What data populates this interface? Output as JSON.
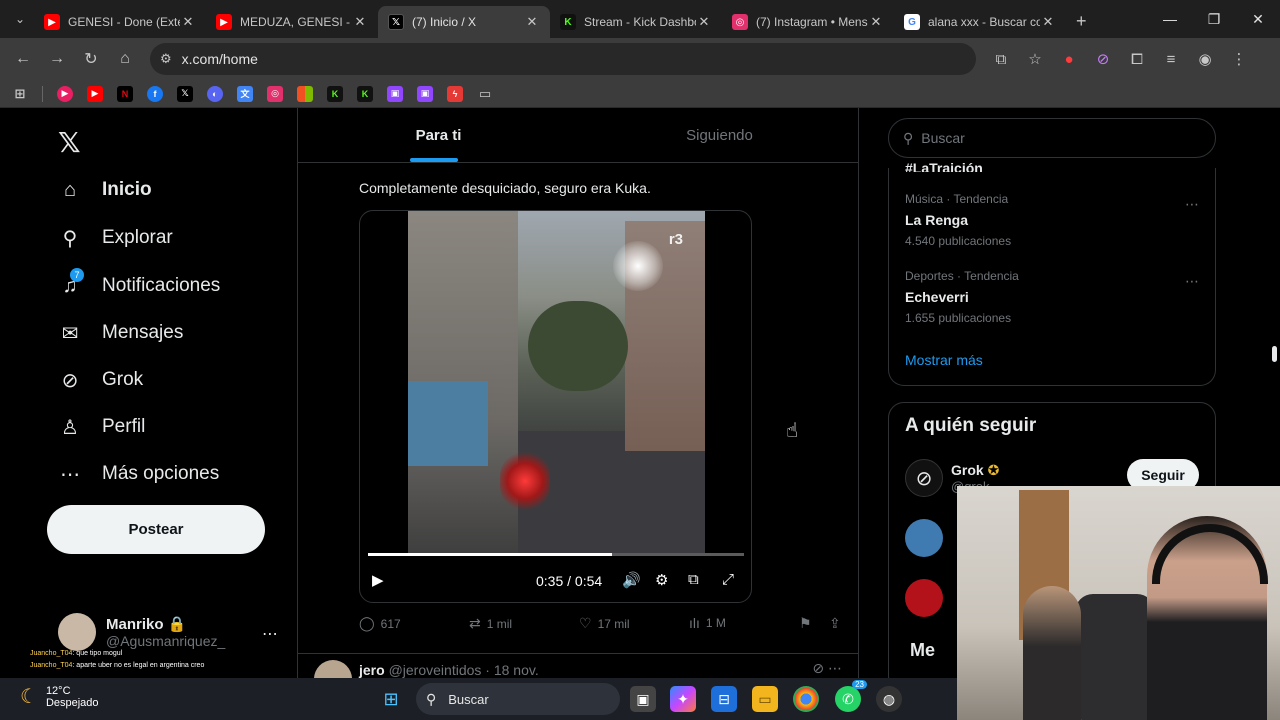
{
  "browser": {
    "tabs": [
      {
        "title": "GENESI - Done (Exter",
        "favicon_color": "#ff0000",
        "favicon": "youtube-icon"
      },
      {
        "title": "MEDUZA, GENESI - F",
        "favicon_color": "#ff0000",
        "favicon": "youtube-icon"
      },
      {
        "title": "(7) Inicio / X",
        "favicon_color": "#000000",
        "favicon": "x-logo-icon"
      },
      {
        "title": "Stream - Kick Dashbo",
        "favicon_color": "#53fc18",
        "favicon": "kick-icon"
      },
      {
        "title": "(7) Instagram • Mens",
        "favicon_color": "#e1306c",
        "favicon": "instagram-icon"
      },
      {
        "title": "alana xxx - Buscar co",
        "favicon_color": "#4285f4",
        "favicon": "google-icon"
      }
    ],
    "active_tab": 2,
    "address": "x.com/home"
  },
  "left_nav": {
    "items": [
      {
        "label": "Inicio",
        "icon": "home-icon",
        "bold": true
      },
      {
        "label": "Explorar",
        "icon": "search-icon"
      },
      {
        "label": "Notificaciones",
        "icon": "bell-icon",
        "badge": "7"
      },
      {
        "label": "Mensajes",
        "icon": "mail-icon"
      },
      {
        "label": "Grok",
        "icon": "grok-icon"
      },
      {
        "label": "Perfil",
        "icon": "person-icon"
      },
      {
        "label": "Más opciones",
        "icon": "more-circle-icon"
      }
    ],
    "post_button": "Postear",
    "account": {
      "name": "Manriko",
      "handle": "@Agusmanriquez_"
    }
  },
  "chat_overlay": {
    "lines": [
      {
        "user": "Juancho_T04",
        "text": ": que tipo mogul"
      },
      {
        "user": "Juancho_T04",
        "text": ": aparte uber no es legal en argentina creo"
      }
    ]
  },
  "feed": {
    "tabs": [
      "Para ti",
      "Siguiendo"
    ],
    "active_tab": 0,
    "post": {
      "text": "Completamente desquiciado, seguro era Kuka.",
      "video": {
        "watermark": "r3",
        "time": "0:35 / 0:54",
        "progress": 0.648
      },
      "actions": {
        "replies": "617",
        "reposts": "1 mil",
        "likes": "17 mil",
        "views": "1 M"
      }
    },
    "next_post": {
      "name": "jero",
      "handle": "@jeroveintidos",
      "date": "· 18 nov."
    }
  },
  "sidebar": {
    "search_placeholder": "Buscar",
    "trends_cut_label": "#LaTraición",
    "trends": [
      {
        "context": "Música · Tendencia",
        "name": "La Renga",
        "count": "4.540 publicaciones"
      },
      {
        "context": "Deportes · Tendencia",
        "name": "Echeverri",
        "count": "1.655 publicaciones"
      }
    ],
    "show_more": "Mostrar más",
    "who_to_follow": {
      "title": "A quién seguir",
      "first": {
        "name": "Grok",
        "handle": "@grok"
      },
      "follow_button": "Seguir"
    },
    "messages_peek": "Me"
  },
  "taskbar": {
    "weather": {
      "temp": "12°C",
      "condition": "Despejado"
    },
    "search": "Buscar",
    "whatsapp_badge": "23"
  }
}
